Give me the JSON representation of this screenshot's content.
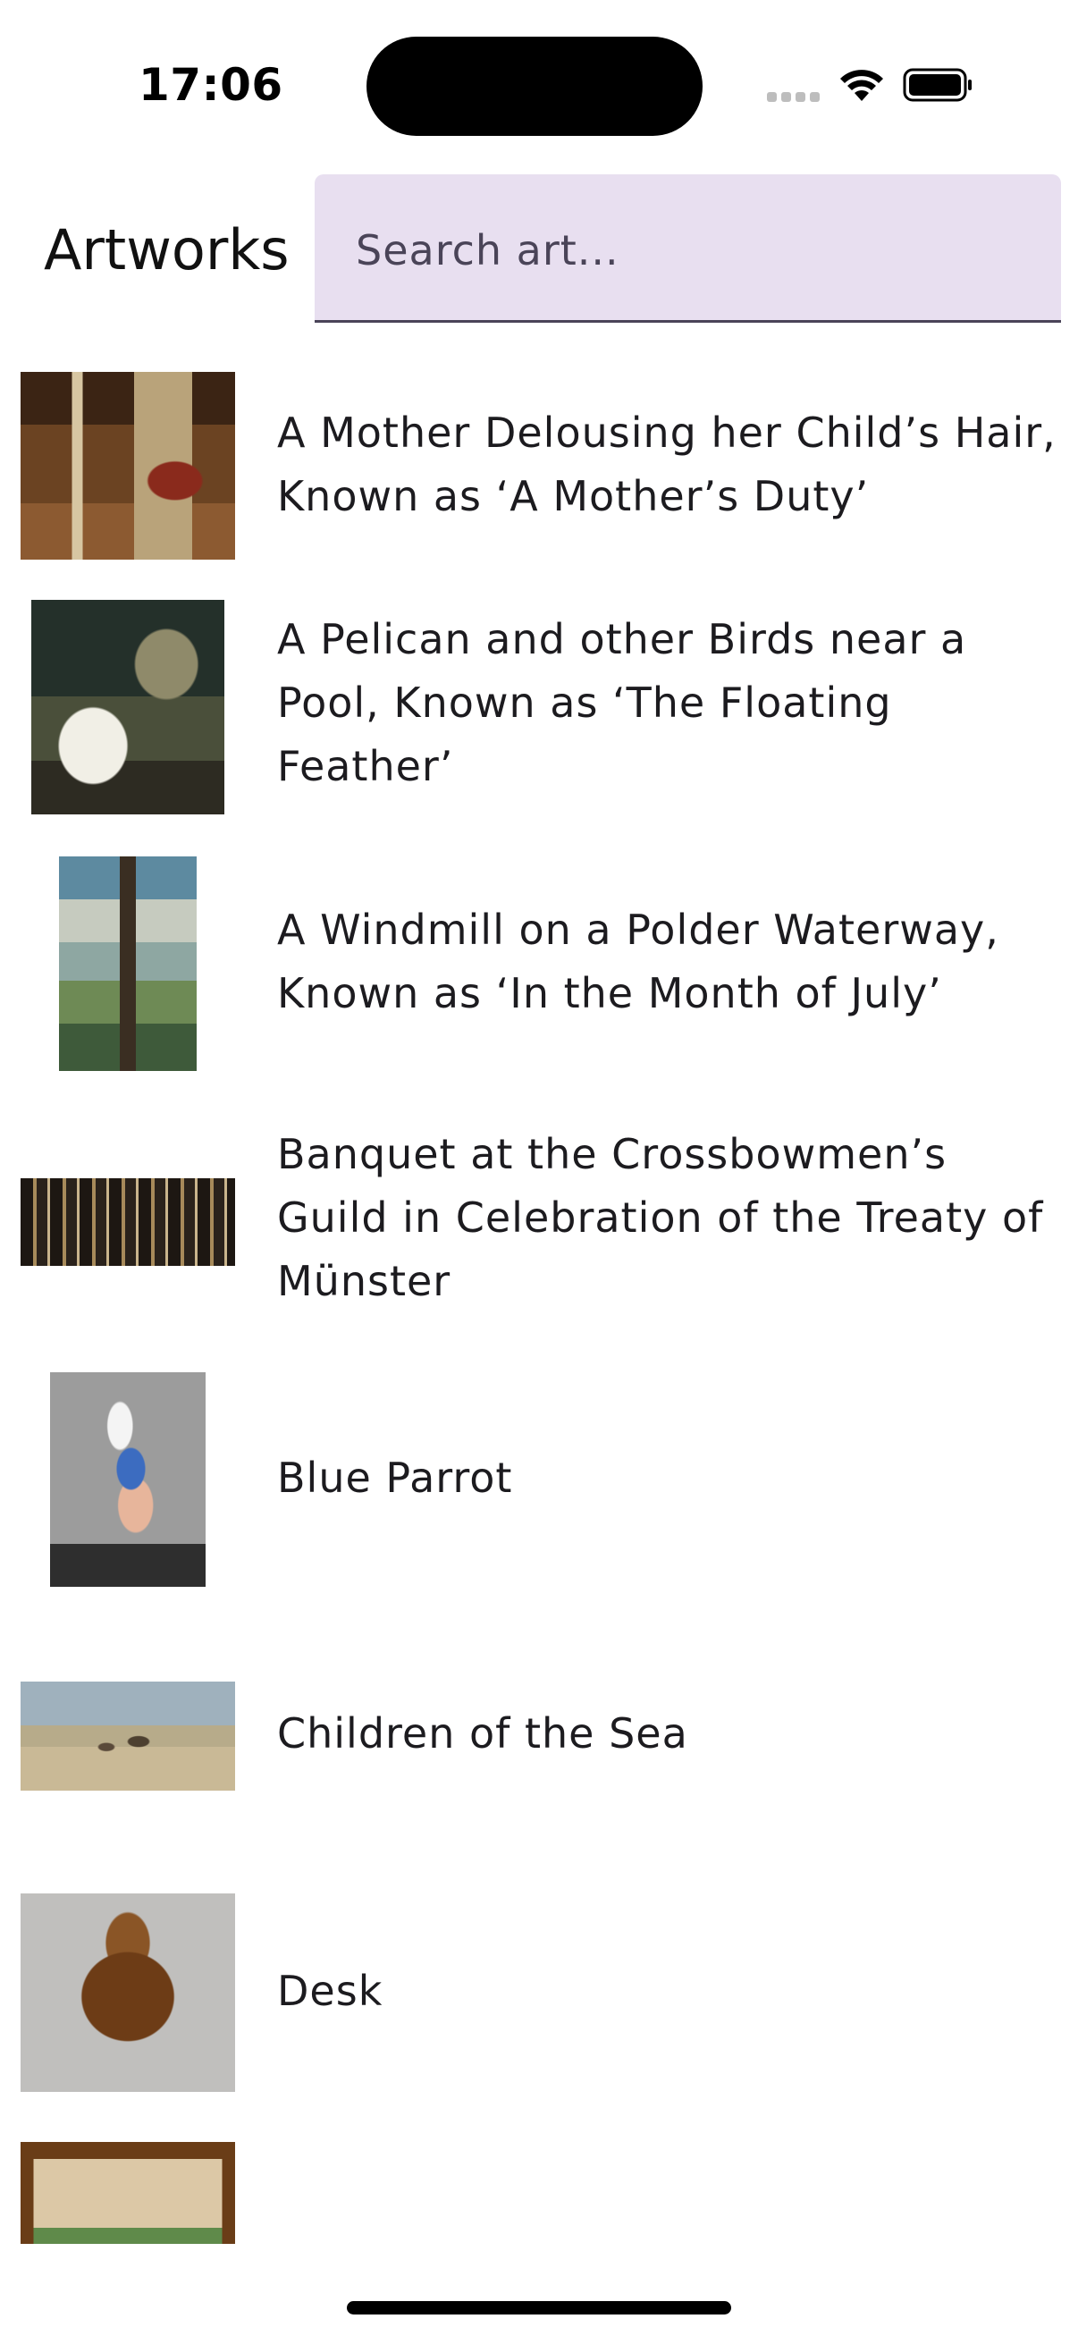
{
  "status_bar": {
    "time": "17:06"
  },
  "header": {
    "title": "Artworks",
    "search": {
      "placeholder": "Search art...",
      "value": ""
    }
  },
  "artworks": [
    {
      "title": "A Mother Delousing her Child’s Hair, Known as ‘A Mother’s Duty’"
    },
    {
      "title": "A Pelican and other Birds near a Pool, Known as ‘The Floating Feather’"
    },
    {
      "title": "A Windmill on a Polder Waterway, Known as ‘In the Month of July’"
    },
    {
      "title": "Banquet at the Crossbowmen’s Guild in Celebration of the Treaty of Münster"
    },
    {
      "title": "Blue Parrot"
    },
    {
      "title": "Children of the Sea"
    },
    {
      "title": "Desk"
    },
    {
      "title": ""
    }
  ]
}
